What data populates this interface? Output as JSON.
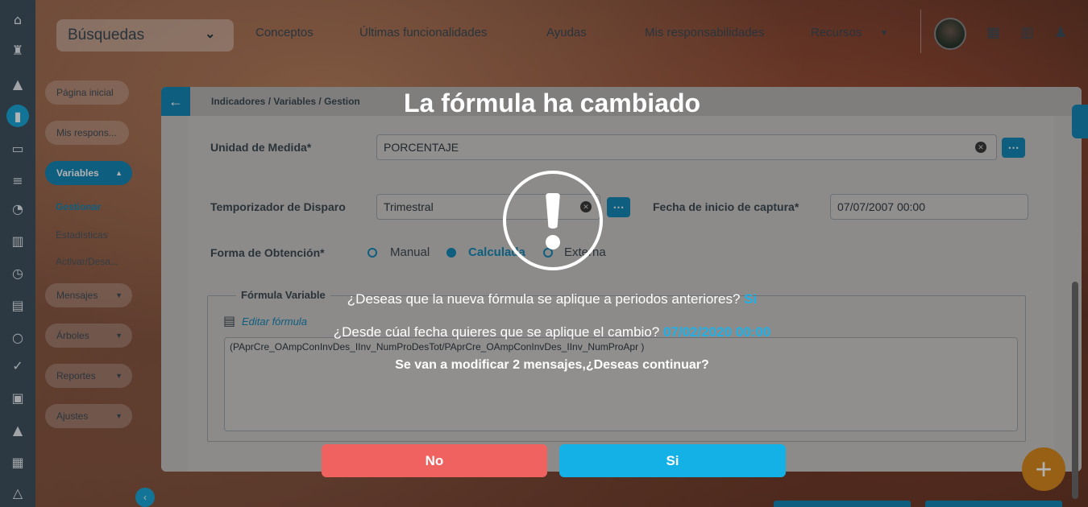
{
  "header": {
    "search_label": "Búsquedas",
    "nav": [
      "Conceptos",
      "Últimas funcionalidades",
      "Ayudas",
      "Mis responsabilidades",
      "Recursos"
    ]
  },
  "rail_icons": [
    "home-icon",
    "chess-icon",
    "triangle-icon",
    "chart-icon",
    "monitor-icon",
    "bars-icon",
    "pie-icon",
    "books-icon",
    "clock-icon",
    "list-icon",
    "circle-icon",
    "check-icon",
    "briefcase-icon",
    "warning-icon",
    "calendar-icon",
    "network-icon"
  ],
  "submenu": {
    "home": "Página inicial",
    "mis": "Mis respons...",
    "variables": "Variables",
    "gestionar": "Gestionar",
    "estadisticas": "Estadísticas",
    "activar": "Activar/Desa...",
    "mensajes": "Mensajes",
    "arboles": "Árboles",
    "reportes": "Reportes",
    "ajustes": "Ajustes"
  },
  "card": {
    "breadcrumb": "Indicadores / Variables / Gestion",
    "unidad_label": "Unidad de Medida*",
    "unidad_value": "PORCENTAJE",
    "temporizador_label": "Temporizador de Disparo",
    "temporizador_value": "Trimestral",
    "fecha_label": "Fecha de inicio de captura*",
    "fecha_value": "07/07/2007 00:00",
    "forma_label": "Forma de Obtención*",
    "opt_manual": "Manual",
    "opt_calculada": "Calculada",
    "opt_externa": "Externa",
    "formula_legend": "Fórmula Variable",
    "edit_formula": "Editar fórmula",
    "formula_text": "(PAprCre_OAmpConInvDes_IInv_NumProDesTot/PAprCre_OAmpConInvDes_IInv_NumProApr )"
  },
  "dialog": {
    "title": "La fórmula ha cambiado",
    "q1": "¿Deseas que la nueva fórmula se aplique a periodos anteriores?",
    "q1_answer": "Si",
    "q2": "¿Desde cúal fecha quieres que se aplique el cambio?",
    "q2_answer": "07/02/2020 00:00",
    "q3": "Se van a modificar 2 mensajes,¿Deseas continuar?",
    "btn_no": "No",
    "btn_yes": "Si"
  },
  "colors": {
    "accent": "#1587b6",
    "dialog_no": "#f0625f",
    "dialog_yes": "#14b1e6",
    "highlight": "#1fb0e8",
    "fab": "#d98a1e"
  }
}
